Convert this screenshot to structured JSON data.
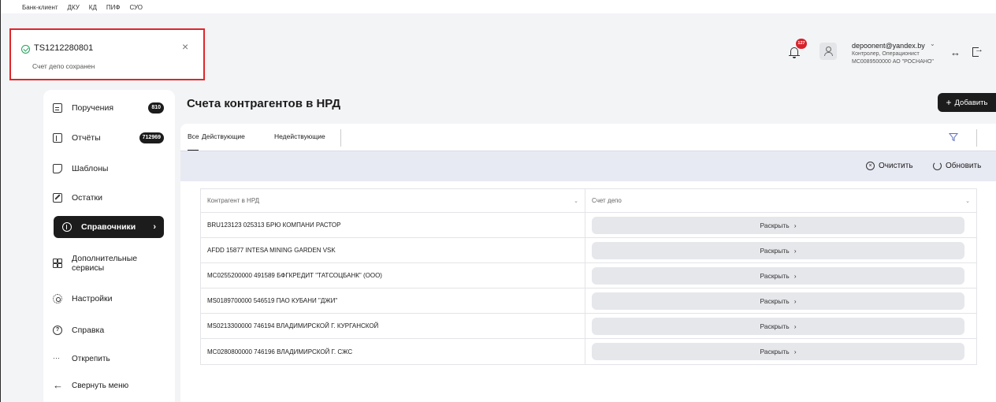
{
  "top_menu": [
    "Банк-клиент",
    "ДКУ",
    "КД",
    "ПИФ",
    "СУО"
  ],
  "toast": {
    "title": "TS1212280801",
    "message": "Счет депо сохранен"
  },
  "header": {
    "notifications_badge": "127",
    "user_email": "depoonent@yandex.by",
    "user_roles": "Контролер, Операционист",
    "user_org": "MC0089500000 АО \"РОСНАНО\""
  },
  "sidebar": {
    "items": [
      {
        "label": "Поручения",
        "badge": "810",
        "icon": "document-icon"
      },
      {
        "label": "Отчёты",
        "badge": "712969",
        "icon": "report-icon"
      },
      {
        "label": "Шаблоны",
        "icon": "template-icon"
      },
      {
        "label": "Остатки",
        "icon": "edit-icon"
      },
      {
        "label": "Справочники",
        "icon": "info-icon",
        "active": true
      },
      {
        "label": "Дополнительные сервисы",
        "icon": "grid-icon"
      },
      {
        "label": "Настройки",
        "icon": "gear-icon"
      },
      {
        "label": "Справка",
        "icon": "help-icon"
      },
      {
        "label": "Открепить",
        "icon": "dots-icon"
      },
      {
        "label": "Свернуть меню",
        "icon": "arrow-left-icon"
      }
    ]
  },
  "main": {
    "title": "Счета контрагентов в НРД",
    "add_label": "Добавить",
    "tabs": [
      "Все",
      "Действующие",
      "Недействующие"
    ],
    "active_tab": "Все",
    "toolbar": {
      "clear_label": "Очистить",
      "refresh_label": "Обновить"
    },
    "table": {
      "columns": [
        "Контрагент в НРД",
        "Счет депо"
      ],
      "expand_label": "Раскрыть",
      "rows": [
        "BRU123123 025313 БРЮ КОМПАНИ РАСТОР",
        "AFDD 15877 INTESA MINING GARDEN VSK",
        "MC0255200000 491589 БФГКРЕДИТ \"ТАТСОЦБАНК\" (ООО)",
        "MS0189700000 546519 ПАО КУБАНИ \"ДЖИ\"",
        "MS0213300000 746194 ВЛАДИМИРСКОЙ Г. КУРГАНСКОЙ",
        "MC0280800000 746196 ВЛАДИМИРСКОЙ Г. СЖС"
      ]
    }
  },
  "colors": {
    "accent_dark": "#1c1c1c",
    "toast_border": "#e0262a",
    "success": "#22a35a",
    "badge_red": "#d7212b",
    "toolbar_bg": "#e8eaf3"
  }
}
